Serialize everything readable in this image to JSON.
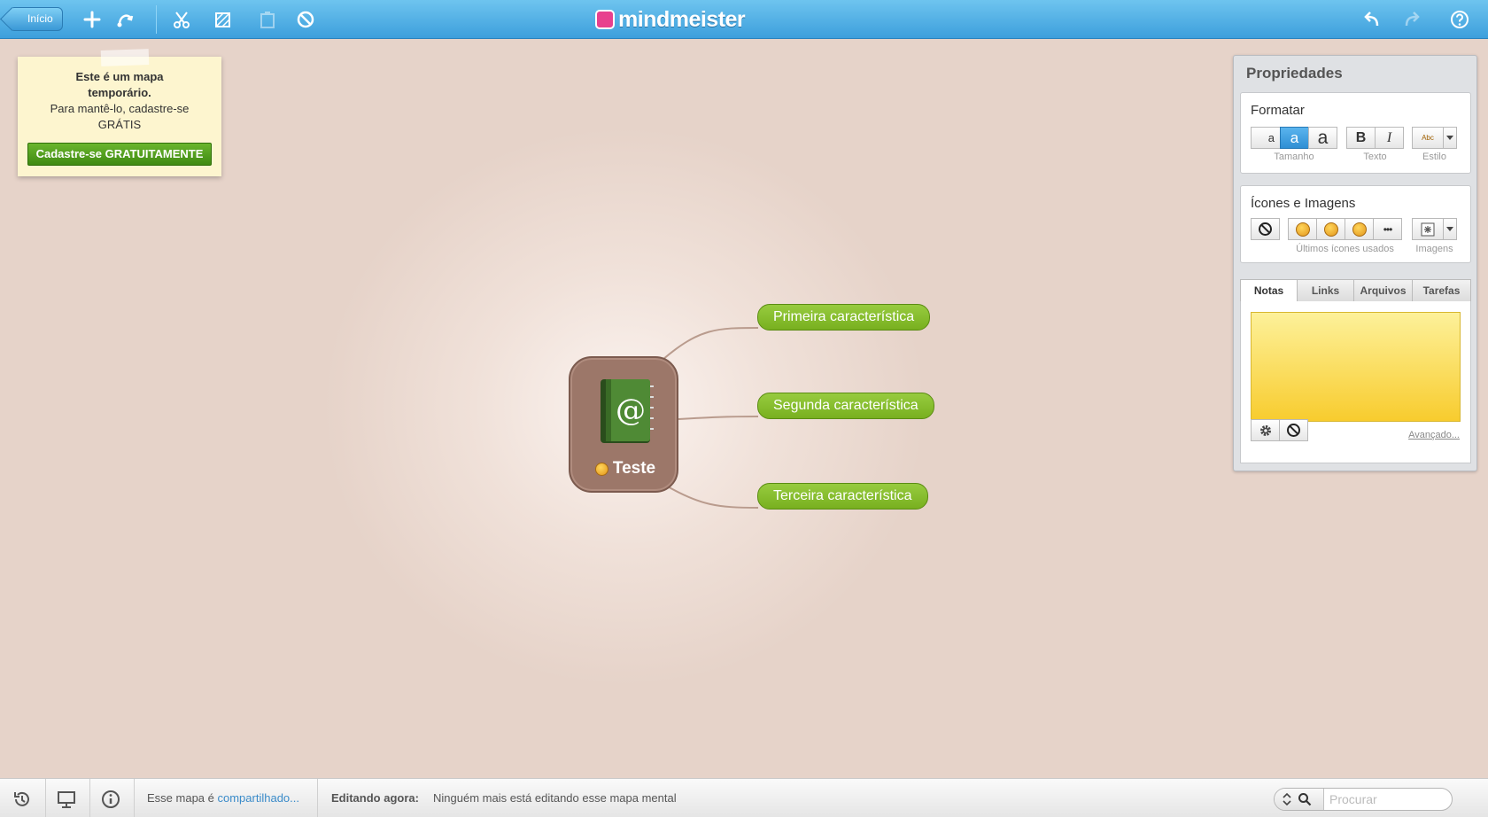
{
  "topbar": {
    "back_label": "Início",
    "logo_part1": "mind",
    "logo_part2": "meister"
  },
  "note": {
    "title": "Este é um mapa temporário.",
    "body": "Para mantê-lo, cadastre-se GRÁTIS",
    "button": "Cadastre-se GRATUITAMENTE"
  },
  "map": {
    "root": "Teste",
    "children": [
      "Primeira característica",
      "Segunda característica",
      "Terceira característica"
    ]
  },
  "props": {
    "title": "Propriedades",
    "format": {
      "title": "Formatar",
      "size_small": "a",
      "size_medium": "a",
      "size_large": "a",
      "bold": "B",
      "italic": "I",
      "style_sample": "Abc",
      "cap_size": "Tamanho",
      "cap_text": "Texto",
      "cap_style": "Estilo"
    },
    "icons": {
      "title": "Ícones e Imagens",
      "cap_recent": "Últimos ícones usados",
      "cap_images": "Imagens",
      "more": "•••"
    },
    "tabs": [
      "Notas",
      "Links",
      "Arquivos",
      "Tarefas"
    ],
    "advanced": "Avançado..."
  },
  "bottombar": {
    "shared_prefix": "Esse mapa é",
    "shared_link": "compartilhado...",
    "editing_label": "Editando agora:",
    "editing_value": "Ninguém mais está editando esse mapa mental",
    "search_placeholder": "Procurar"
  },
  "colors": {
    "topbar": "#3d9fdc",
    "canvas": "#e6d3c9",
    "node_green": "#86bd2e",
    "root_brown": "#9c7769",
    "accent_blue": "#2f8fd4"
  }
}
